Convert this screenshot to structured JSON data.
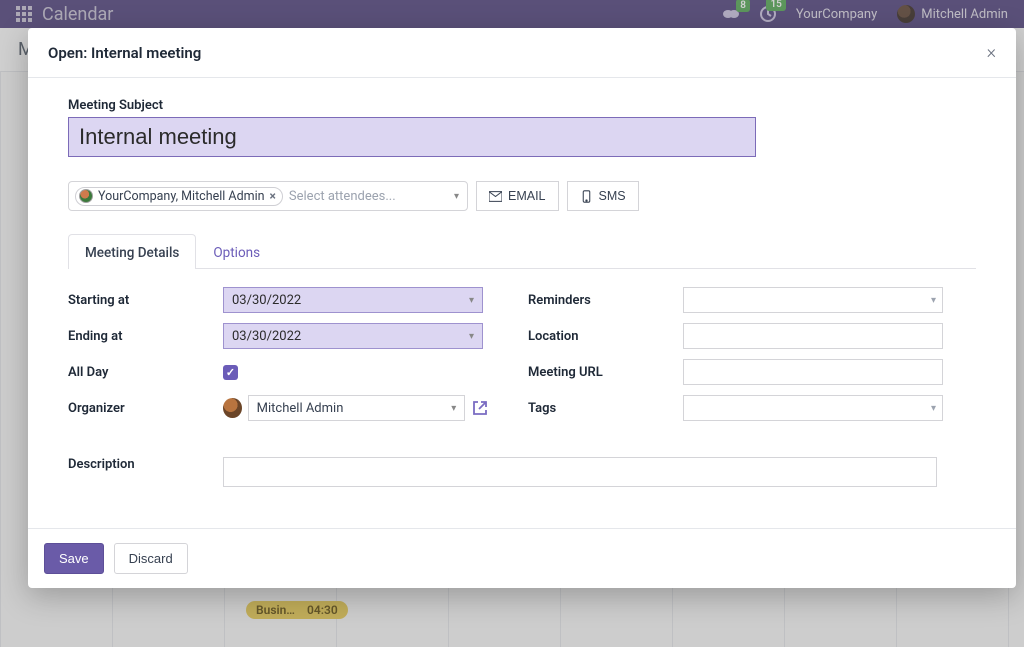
{
  "topnav": {
    "app_title": "Calendar",
    "chat_badge": "8",
    "activity_badge": "15",
    "company": "YourCompany",
    "user_name": "Mitchell Admin"
  },
  "subbar": {
    "initial": "M"
  },
  "bg_event": {
    "title": "Busin…",
    "time": "04:30"
  },
  "modal": {
    "title": "Open: Internal meeting",
    "subject_label": "Meeting Subject",
    "subject_value": "Internal meeting",
    "attendee_chip": "YourCompany, Mitchell Admin",
    "attendee_placeholder": "Select attendees...",
    "email_btn": "EMAIL",
    "sms_btn": "SMS",
    "tabs": {
      "details": "Meeting Details",
      "options": "Options"
    },
    "labels": {
      "starting": "Starting at",
      "ending": "Ending at",
      "allday": "All Day",
      "organizer": "Organizer",
      "reminders": "Reminders",
      "location": "Location",
      "url": "Meeting URL",
      "tags": "Tags",
      "description": "Description"
    },
    "starting_value": "03/30/2022",
    "ending_value": "03/30/2022",
    "all_day_checked": true,
    "organizer_value": "Mitchell Admin",
    "footer": {
      "save": "Save",
      "discard": "Discard"
    }
  }
}
